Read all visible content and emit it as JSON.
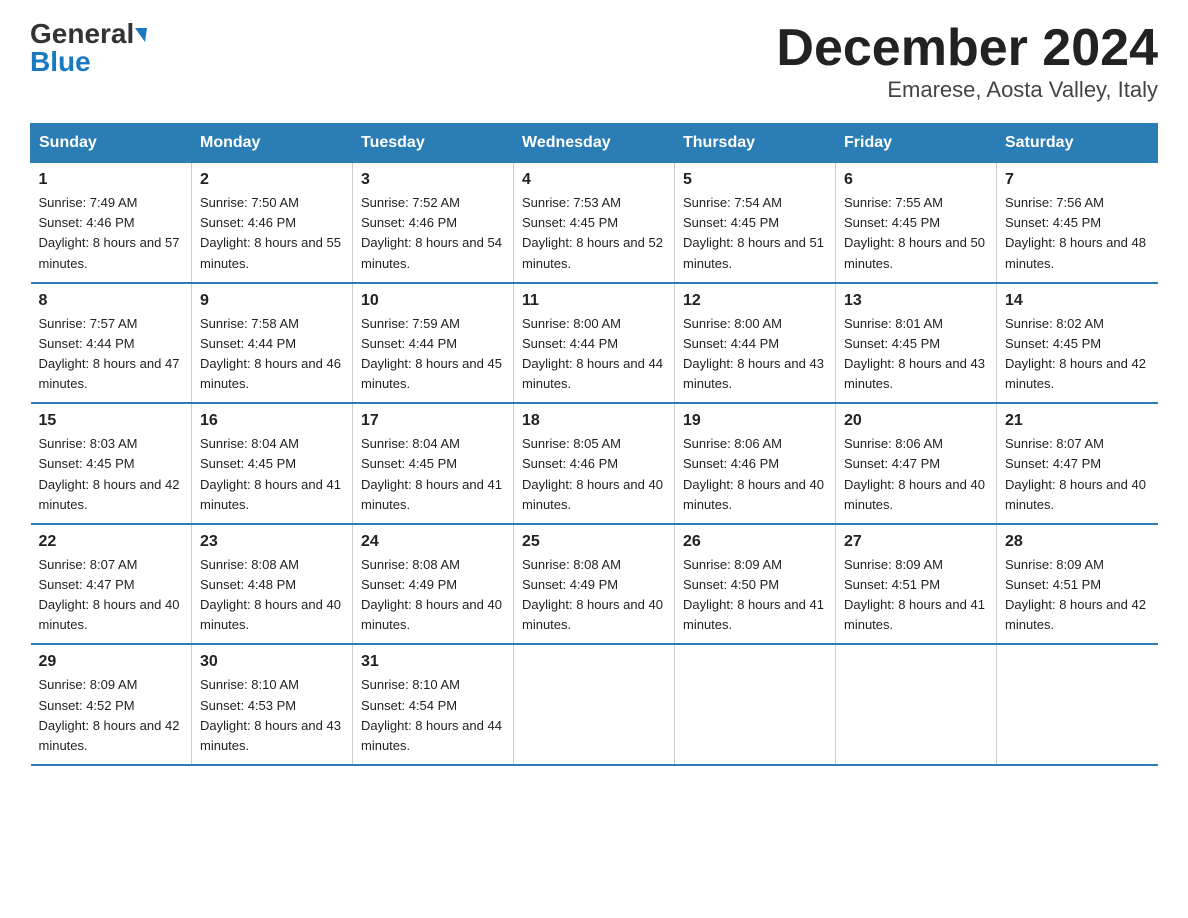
{
  "logo": {
    "part1": "General",
    "part2": "Blue"
  },
  "title": "December 2024",
  "subtitle": "Emarese, Aosta Valley, Italy",
  "days_header": [
    "Sunday",
    "Monday",
    "Tuesday",
    "Wednesday",
    "Thursday",
    "Friday",
    "Saturday"
  ],
  "weeks": [
    [
      {
        "num": "1",
        "sunrise": "7:49 AM",
        "sunset": "4:46 PM",
        "daylight": "8 hours and 57 minutes."
      },
      {
        "num": "2",
        "sunrise": "7:50 AM",
        "sunset": "4:46 PM",
        "daylight": "8 hours and 55 minutes."
      },
      {
        "num": "3",
        "sunrise": "7:52 AM",
        "sunset": "4:46 PM",
        "daylight": "8 hours and 54 minutes."
      },
      {
        "num": "4",
        "sunrise": "7:53 AM",
        "sunset": "4:45 PM",
        "daylight": "8 hours and 52 minutes."
      },
      {
        "num": "5",
        "sunrise": "7:54 AM",
        "sunset": "4:45 PM",
        "daylight": "8 hours and 51 minutes."
      },
      {
        "num": "6",
        "sunrise": "7:55 AM",
        "sunset": "4:45 PM",
        "daylight": "8 hours and 50 minutes."
      },
      {
        "num": "7",
        "sunrise": "7:56 AM",
        "sunset": "4:45 PM",
        "daylight": "8 hours and 48 minutes."
      }
    ],
    [
      {
        "num": "8",
        "sunrise": "7:57 AM",
        "sunset": "4:44 PM",
        "daylight": "8 hours and 47 minutes."
      },
      {
        "num": "9",
        "sunrise": "7:58 AM",
        "sunset": "4:44 PM",
        "daylight": "8 hours and 46 minutes."
      },
      {
        "num": "10",
        "sunrise": "7:59 AM",
        "sunset": "4:44 PM",
        "daylight": "8 hours and 45 minutes."
      },
      {
        "num": "11",
        "sunrise": "8:00 AM",
        "sunset": "4:44 PM",
        "daylight": "8 hours and 44 minutes."
      },
      {
        "num": "12",
        "sunrise": "8:00 AM",
        "sunset": "4:44 PM",
        "daylight": "8 hours and 43 minutes."
      },
      {
        "num": "13",
        "sunrise": "8:01 AM",
        "sunset": "4:45 PM",
        "daylight": "8 hours and 43 minutes."
      },
      {
        "num": "14",
        "sunrise": "8:02 AM",
        "sunset": "4:45 PM",
        "daylight": "8 hours and 42 minutes."
      }
    ],
    [
      {
        "num": "15",
        "sunrise": "8:03 AM",
        "sunset": "4:45 PM",
        "daylight": "8 hours and 42 minutes."
      },
      {
        "num": "16",
        "sunrise": "8:04 AM",
        "sunset": "4:45 PM",
        "daylight": "8 hours and 41 minutes."
      },
      {
        "num": "17",
        "sunrise": "8:04 AM",
        "sunset": "4:45 PM",
        "daylight": "8 hours and 41 minutes."
      },
      {
        "num": "18",
        "sunrise": "8:05 AM",
        "sunset": "4:46 PM",
        "daylight": "8 hours and 40 minutes."
      },
      {
        "num": "19",
        "sunrise": "8:06 AM",
        "sunset": "4:46 PM",
        "daylight": "8 hours and 40 minutes."
      },
      {
        "num": "20",
        "sunrise": "8:06 AM",
        "sunset": "4:47 PM",
        "daylight": "8 hours and 40 minutes."
      },
      {
        "num": "21",
        "sunrise": "8:07 AM",
        "sunset": "4:47 PM",
        "daylight": "8 hours and 40 minutes."
      }
    ],
    [
      {
        "num": "22",
        "sunrise": "8:07 AM",
        "sunset": "4:47 PM",
        "daylight": "8 hours and 40 minutes."
      },
      {
        "num": "23",
        "sunrise": "8:08 AM",
        "sunset": "4:48 PM",
        "daylight": "8 hours and 40 minutes."
      },
      {
        "num": "24",
        "sunrise": "8:08 AM",
        "sunset": "4:49 PM",
        "daylight": "8 hours and 40 minutes."
      },
      {
        "num": "25",
        "sunrise": "8:08 AM",
        "sunset": "4:49 PM",
        "daylight": "8 hours and 40 minutes."
      },
      {
        "num": "26",
        "sunrise": "8:09 AM",
        "sunset": "4:50 PM",
        "daylight": "8 hours and 41 minutes."
      },
      {
        "num": "27",
        "sunrise": "8:09 AM",
        "sunset": "4:51 PM",
        "daylight": "8 hours and 41 minutes."
      },
      {
        "num": "28",
        "sunrise": "8:09 AM",
        "sunset": "4:51 PM",
        "daylight": "8 hours and 42 minutes."
      }
    ],
    [
      {
        "num": "29",
        "sunrise": "8:09 AM",
        "sunset": "4:52 PM",
        "daylight": "8 hours and 42 minutes."
      },
      {
        "num": "30",
        "sunrise": "8:10 AM",
        "sunset": "4:53 PM",
        "daylight": "8 hours and 43 minutes."
      },
      {
        "num": "31",
        "sunrise": "8:10 AM",
        "sunset": "4:54 PM",
        "daylight": "8 hours and 44 minutes."
      },
      null,
      null,
      null,
      null
    ]
  ]
}
